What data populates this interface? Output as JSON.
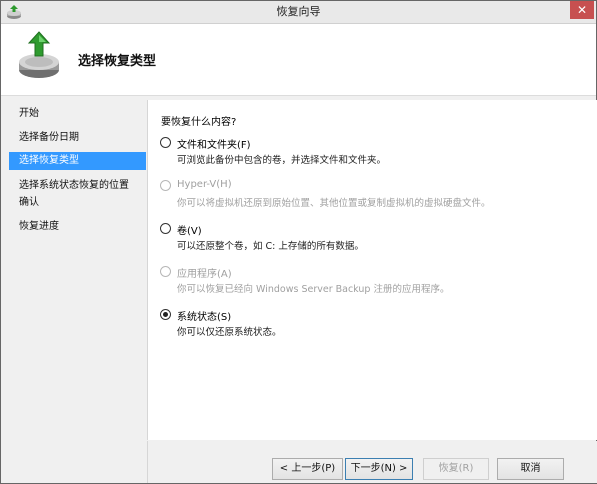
{
  "window": {
    "title": "恢复向导",
    "close_glyph": "✕"
  },
  "header": {
    "title": "选择恢复类型"
  },
  "sidebar": {
    "steps": [
      {
        "label": "开始"
      },
      {
        "label": "选择备份日期"
      },
      {
        "label": "选择恢复类型",
        "active": true
      },
      {
        "label": "选择系统状态恢复的位置"
      },
      {
        "label": "确认"
      },
      {
        "label": "恢复进度"
      }
    ]
  },
  "content": {
    "question": "要恢复什么内容?",
    "options": [
      {
        "label": "文件和文件夹(F)",
        "desc": "可浏览此备份中包含的卷，并选择文件和文件夹。",
        "enabled": true,
        "checked": false
      },
      {
        "label": "Hyper-V(H)",
        "desc": "你可以将虚拟机还原到原始位置、其他位置或复制虚拟机的虚拟硬盘文件。",
        "enabled": false,
        "checked": false
      },
      {
        "label": "卷(V)",
        "desc": "可以还原整个卷，如 C: 上存储的所有数据。",
        "enabled": true,
        "checked": false
      },
      {
        "label": "应用程序(A)",
        "desc": "你可以恢复已经向 Windows Server Backup 注册的应用程序。",
        "enabled": false,
        "checked": false
      },
      {
        "label": "系统状态(S)",
        "desc": "你可以仅还原系统状态。",
        "enabled": true,
        "checked": true
      }
    ]
  },
  "footer": {
    "back_label": "< 上一步(P)",
    "next_label": "下一步(N) >",
    "recover_label": "恢复(R)",
    "cancel_label": "取消"
  },
  "colors": {
    "accent": "#3399ff",
    "close": "#c75050"
  }
}
